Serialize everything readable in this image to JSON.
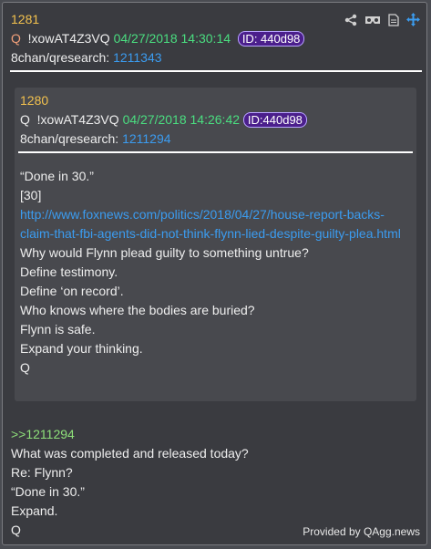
{
  "outer": {
    "post_number": "1281",
    "author_q": "Q",
    "tripcode": "!xowAT4Z3VQ",
    "date": "04/27/2018 14:30:14",
    "id": "ID: 440d98",
    "board": "8chan/qresearch:",
    "board_num": "1211343"
  },
  "quoted": {
    "post_number": "1280",
    "author_q": "Q",
    "tripcode": "!xowAT4Z3VQ",
    "date": "04/27/2018 14:26:42",
    "id": "ID:440d98",
    "board": "8chan/qresearch:",
    "board_num": "1211294",
    "lines": [
      "“Done in 30.”",
      "[30]"
    ],
    "url_line1": "http://www.foxnews.com/politics/2018/04/27/house-report-backs-",
    "url_line2": "claim-that-fbi-agents-did-not-think-flynn-lied-despite-guilty-plea.html",
    "body": [
      "Why would Flynn plead guilty to something untrue?",
      "Define testimony.",
      "Define ‘on record’.",
      "Who knows where the bodies are buried?",
      "Flynn is safe.",
      "Expand your thinking.",
      "Q"
    ]
  },
  "reply": {
    "ref": ">>1211294",
    "lines": [
      "What was completed and released today?",
      "Re: Flynn?",
      "“Done in 30.”",
      "Expand.",
      "Q"
    ]
  },
  "footer": "Provided by QAgg.news",
  "icons": [
    "share-icon",
    "vr-goggles-icon",
    "document-icon",
    "move-icon"
  ],
  "colors": {
    "post_number": "#f2c14e",
    "date": "#4ade80",
    "link": "#3b9cf0",
    "reply_ref": "#8ee07a",
    "id_badge": "#4b1f8c"
  }
}
